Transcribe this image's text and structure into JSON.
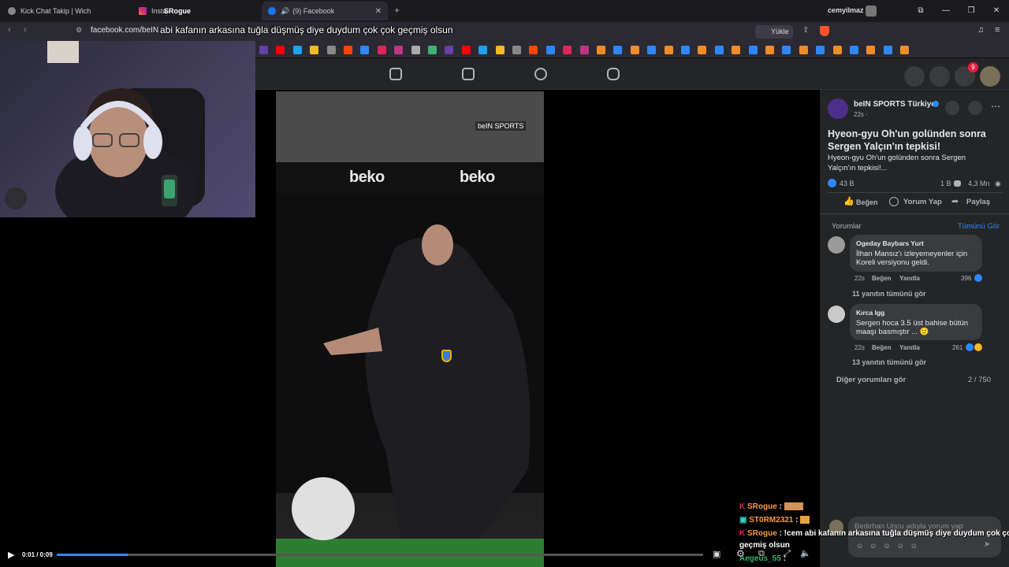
{
  "browser": {
    "tabs": [
      {
        "title": "Kick Chat Takip | Wich"
      },
      {
        "title": "Insta"
      },
      {
        "title": "SRogue"
      },
      {
        "title": "(9) Facebook"
      }
    ],
    "profile_name": "cemyilmaz",
    "url": "facebook.com/beIN",
    "upload_label": "Yükle"
  },
  "stream_overlay": {
    "message": "abi kafanın arkasına tuğla düşmüş diye duydum çok çok geçmiş olsun"
  },
  "facebook": {
    "notification_count": "9"
  },
  "video": {
    "watermark": "beIN SPORTS",
    "ad_boards": [
      "beko",
      "beko"
    ],
    "time": "0:01 / 0:09",
    "progress": 0.11
  },
  "post": {
    "page_name": "beIN SPORTS Türkiye",
    "time": "22s ·",
    "title": "Hyeon-gyu Oh'un golünden sonra Sergen Yalçın'ın tepkisi!",
    "description_line1": "Hyeon-gyu Oh'un golünden sonra Sergen",
    "description_line2": "Yalçın'ın tepkisi!...",
    "reactions": "43 B",
    "comments_count": "1 B",
    "views": "4,3 Mn",
    "like_label": "Beğen",
    "comment_label": "Yorum Yap",
    "share_label": "Paylaş"
  },
  "comments_section": {
    "header": "Yorumlar",
    "see_all": "Tümünü Gör",
    "comments": [
      {
        "author": "Ogeday Baybars Yurt",
        "line1": "İlhan Mansız'ı izleyemeyenler için",
        "line2": "Koreli versiyonu geldi.",
        "time": "22s",
        "like": "Beğen",
        "reply": "Yanıtla",
        "count": "396",
        "replies": "11 yanıtın tümünü gör"
      },
      {
        "author": "Kırca Igg",
        "line1": "Sergen hoca 3.5 üst bahise bütün",
        "line2": "maaşı basmıştır ... 🙂",
        "time": "22s",
        "like": "Beğen",
        "reply": "Yanıtla",
        "count": "261",
        "replies": "13 yanıtın tümünü gör"
      }
    ],
    "more_comments": "Diğer yorumları gör",
    "pagination": "2 / 750",
    "input_placeholder": "Bedirhan Uncu adıyla yorum yap"
  },
  "chat": [
    {
      "user": "SRogue",
      "text": ":",
      "color": "#ff9a3c"
    },
    {
      "user": "ST0RM2321",
      "text": ":",
      "color": "#ff9a3c"
    },
    {
      "user": "SRogue",
      "text": ": !cem abi kafanın arkasına tuğla düşmüş diye duydum çok çok",
      "color": "#ff9a3c"
    },
    {
      "user": "",
      "text": "geçmiş olsun",
      "color": "#ffffff"
    },
    {
      "user": "Aegeus_55",
      "text": ":",
      "color": "#3cb371"
    }
  ],
  "colors": {
    "fb_bg": "#242526",
    "fb_blue": "#2d88ff",
    "chat_name": "#ff9a3c"
  }
}
